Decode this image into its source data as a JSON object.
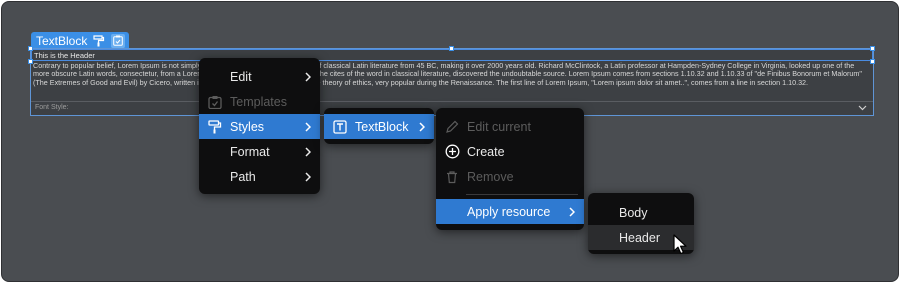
{
  "element": {
    "tag_label": "TextBlock",
    "header_text": "This is the Header",
    "body_text": "Contrary to popular belief, Lorem Ipsum is not simply random text. It has roots in a piece of classical Latin literature from 45 BC, making it over 2000 years old. Richard McClintock, a Latin professor at Hampden-Sydney College in Virginia, looked up one of the more obscure Latin words, consectetur, from a Lorem Ipsum passage, and going through the cites of the word in classical literature, discovered the undoubtable source. Lorem Ipsum comes from sections 1.10.32 and 1.10.33 of \"de Finibus Bonorum et Malorum\" (The Extremes of Good and Evil) by Cicero, written in 45 BC. This book is a treatise on the theory of ethics, very popular during the Renaissance. The first line of Lorem Ipsum, \"Lorem ipsum dolor sit amet..\", comes from a line in section 1.10.32.",
    "font_style_label": "Font Style:"
  },
  "menu1": {
    "items": [
      {
        "label": "Edit",
        "icon": "none",
        "submenu": true,
        "disabled": false,
        "active": false
      },
      {
        "label": "Templates",
        "icon": "template-icon",
        "submenu": false,
        "disabled": true,
        "active": false
      },
      {
        "label": "Styles",
        "icon": "paint-roller-icon",
        "submenu": true,
        "disabled": false,
        "active": true
      },
      {
        "label": "Format",
        "icon": "none",
        "submenu": true,
        "disabled": false,
        "active": false
      },
      {
        "label": "Path",
        "icon": "none",
        "submenu": true,
        "disabled": false,
        "active": false
      }
    ]
  },
  "menu2": {
    "items": [
      {
        "label": "TextBlock",
        "icon": "text-box-icon",
        "submenu": true,
        "active": true
      }
    ]
  },
  "menu3": {
    "items": [
      {
        "label": "Edit current",
        "icon": "pencil-icon",
        "disabled": true
      },
      {
        "label": "Create",
        "icon": "plus-circle-icon",
        "disabled": false
      },
      {
        "label": "Remove",
        "icon": "trash-icon",
        "disabled": true
      },
      {
        "label": "Apply resource",
        "icon": "none",
        "submenu": true,
        "active": true
      }
    ]
  },
  "menu4": {
    "items": [
      {
        "label": "Body",
        "hovered": false
      },
      {
        "label": "Header",
        "hovered": true
      }
    ]
  },
  "colors": {
    "canvas": "#4a4d51",
    "selection": "#3b8fe6",
    "menu_bg": "#0e0e0f",
    "menu_active": "#2f7ad1",
    "menu_hover": "#2b2c2e"
  }
}
